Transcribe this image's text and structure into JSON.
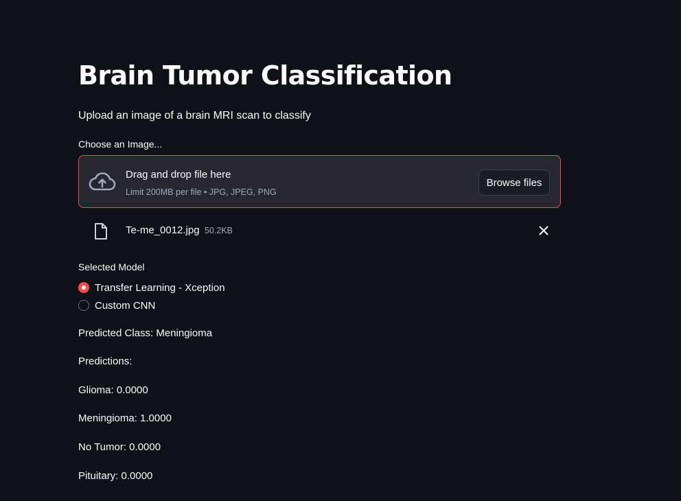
{
  "page": {
    "title": "Brain Tumor Classification",
    "subtitle": "Upload an image of a brain MRI scan to classify"
  },
  "uploader": {
    "label": "Choose an Image...",
    "drop_title": "Drag and drop file here",
    "drop_hint": "Limit 200MB per file • JPG, JPEG, PNG",
    "browse_label": "Browse files",
    "icon": "cloud-upload-icon",
    "accent_color": "#ff4b4b",
    "file": {
      "name": "Te-me_0012.jpg",
      "size": "50.2KB",
      "icon": "file-icon"
    }
  },
  "model_select": {
    "label": "Selected Model",
    "options": [
      {
        "label": "Transfer Learning - Xception",
        "selected": true
      },
      {
        "label": "Custom CNN",
        "selected": false
      }
    ]
  },
  "results": {
    "predicted": "Predicted Class: Meningioma",
    "predictions_header": "Predictions:",
    "lines": [
      "Glioma: 0.0000",
      "Meningioma: 1.0000",
      "No Tumor: 0.0000",
      "Pituitary: 0.0000"
    ]
  },
  "colors": {
    "background": "#0e1117",
    "panel": "#262730",
    "accent": "#ff4b4b",
    "text": "#fafafa",
    "muted": "#a3a8b8"
  }
}
